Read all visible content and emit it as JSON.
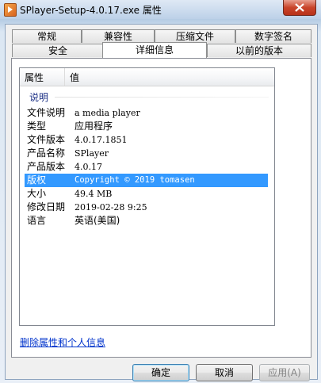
{
  "window": {
    "title": "SPlayer-Setup-4.0.17.exe 属性"
  },
  "tabs_row_back": [
    {
      "label": "常规"
    },
    {
      "label": "兼容性"
    },
    {
      "label": "压缩文件"
    },
    {
      "label": "数字签名"
    }
  ],
  "tabs_row_front": [
    {
      "label": "安全"
    },
    {
      "label": "详细信息",
      "active": true
    },
    {
      "label": "以前的版本"
    }
  ],
  "list": {
    "columns": [
      "属性",
      "值"
    ],
    "group": "说明",
    "rows": [
      {
        "key": "文件说明",
        "value": "a media player"
      },
      {
        "key": "类型",
        "value": "应用程序"
      },
      {
        "key": "文件版本",
        "value": "4.0.17.1851"
      },
      {
        "key": "产品名称",
        "value": "SPlayer"
      },
      {
        "key": "产品版本",
        "value": "4.0.17"
      },
      {
        "key": "版权",
        "value": "Copyright © 2019 tomasen",
        "selected": true
      },
      {
        "key": "大小",
        "value": "49.4 MB"
      },
      {
        "key": "修改日期",
        "value": "2019-02-28 9:25"
      },
      {
        "key": "语言",
        "value": "英语(美国)"
      }
    ]
  },
  "remove_link": "删除属性和个人信息",
  "buttons": {
    "ok": "确定",
    "cancel": "取消",
    "apply": "应用(A)"
  },
  "colors": {
    "selection": "#3399ff",
    "link": "#0033cc",
    "group_label": "#1e3287"
  }
}
